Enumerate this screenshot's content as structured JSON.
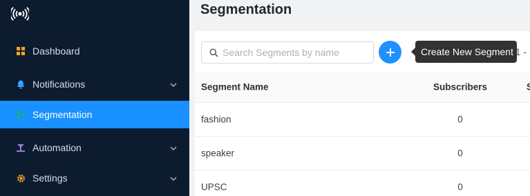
{
  "sidebar": {
    "items": [
      {
        "label": "Dashboard",
        "icon": "dashboard-icon",
        "has_chevron": false
      },
      {
        "label": "Notifications",
        "icon": "bell-icon",
        "has_chevron": true
      },
      {
        "label": "Segmentation",
        "icon": "segmentation-icon",
        "has_chevron": false,
        "active": true
      },
      {
        "label": "Automation",
        "icon": "automation-icon",
        "has_chevron": true
      },
      {
        "label": "Settings",
        "icon": "gear-icon",
        "has_chevron": true
      }
    ]
  },
  "main": {
    "title": "Segmentation",
    "search": {
      "placeholder": "Search Segments by name"
    },
    "add_tooltip": "Create New Segment",
    "paging_text": "g 1 -",
    "table": {
      "columns": [
        "Segment Name",
        "Subscribers",
        "S"
      ],
      "rows": [
        {
          "name": "fashion",
          "subscribers": "0"
        },
        {
          "name": "speaker",
          "subscribers": "0"
        },
        {
          "name": "UPSC",
          "subscribers": "0"
        }
      ]
    }
  },
  "colors": {
    "sidebar_bg": "#0d1b2e",
    "active_bg": "#1890ff",
    "accent": "#1e90ff",
    "tooltip_bg": "#303234"
  }
}
